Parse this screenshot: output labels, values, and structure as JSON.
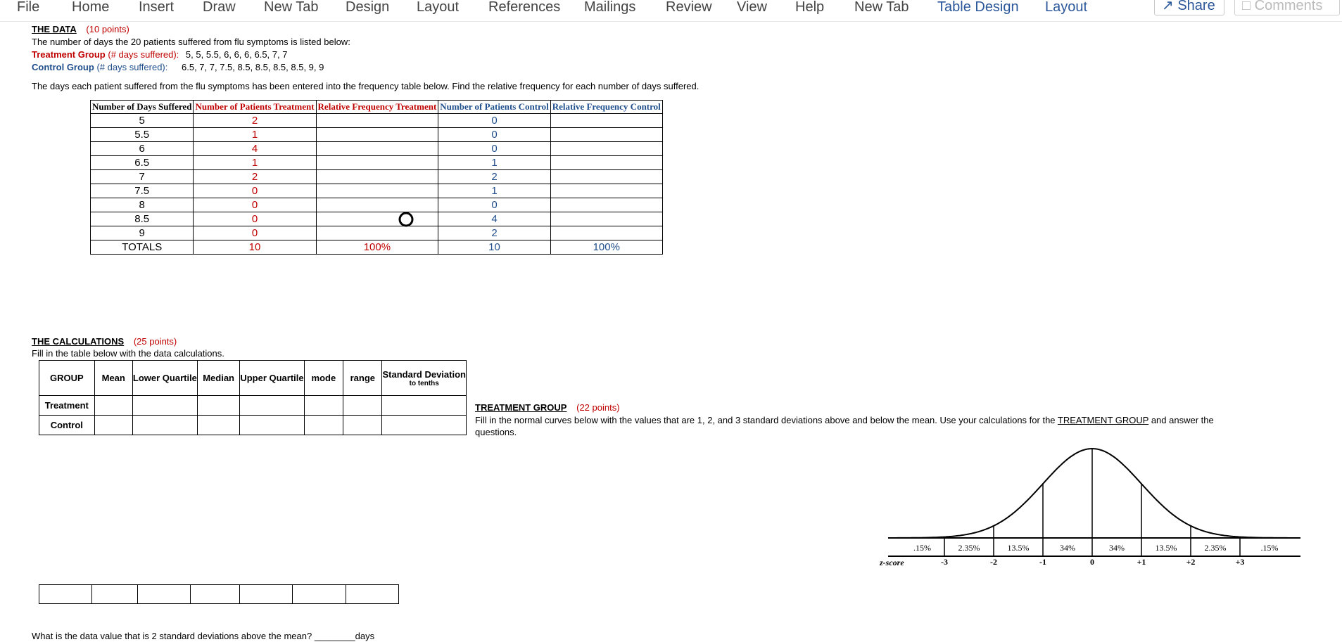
{
  "ribbon": {
    "tabs": [
      "File",
      "Home",
      "Insert",
      "Draw",
      "New Tab",
      "Design",
      "Layout",
      "References",
      "Mailings",
      "Review",
      "View",
      "Help",
      "New Tab",
      "Table Design",
      "Layout"
    ],
    "share_label": "Share",
    "comments_label": "Comments"
  },
  "data_section": {
    "heading": "THE DATA",
    "points": "(10 points)",
    "intro": "The number of days the 20 patients suffered from flu symptoms is listed below:",
    "treatment_label": "Treatment Group",
    "treatment_suffix": "(# days suffered):",
    "treatment_values": "5,   5,  5.5,   6,   6,   6,   6.5,  7,  7",
    "control_label": "Control Group",
    "control_suffix": "(# days suffered):",
    "control_values": "6.5,   7,   7,  7.5,  8.5,  8.5,  8.5,  8.5,  9,  9",
    "instruction": "The days each patient suffered from the flu symptoms has been entered into the frequency table below.  Find the relative frequency for each number of days suffered."
  },
  "freq_table": {
    "headers": [
      "Number of Days Suffered",
      "Number of Patients Treatment",
      "Relative Frequency Treatment",
      "Number of Patients Control",
      "Relative Frequency Control"
    ],
    "rows": [
      {
        "days": "5",
        "treat": "2",
        "control": "0"
      },
      {
        "days": "5.5",
        "treat": "1",
        "control": "0"
      },
      {
        "days": "6",
        "treat": "4",
        "control": "0"
      },
      {
        "days": "6.5",
        "treat": "1",
        "control": "1"
      },
      {
        "days": "7",
        "treat": "2",
        "control": "2"
      },
      {
        "days": "7.5",
        "treat": "0",
        "control": "1"
      },
      {
        "days": "8",
        "treat": "0",
        "control": "0"
      },
      {
        "days": "8.5",
        "treat": "0",
        "control": "4"
      },
      {
        "days": "9",
        "treat": "0",
        "control": "2"
      }
    ],
    "totals": {
      "label": "TOTALS",
      "treat": "10",
      "treat_rel": "100%",
      "control": "10",
      "control_rel": "100%"
    }
  },
  "calc_section": {
    "heading": "THE CALCULATIONS",
    "points": "(25 points)",
    "instruction": "Fill in the table below with the data calculations.",
    "headers": [
      "GROUP",
      "Mean",
      "Lower Quartile",
      "Median",
      "Upper Quartile",
      "mode",
      "range",
      "Standard Deviation"
    ],
    "std_note": "to tenths",
    "rows": [
      "Treatment",
      "Control"
    ]
  },
  "treatment_group": {
    "heading": "TREATMENT GROUP",
    "points": "(22 points)",
    "instruction_a": "Fill in the normal curves below with the values that are 1, 2, and 3 standard deviations above and below the mean.  Use your calculations for the ",
    "instruction_link": "TREATMENT GROUP",
    "instruction_b": " and answer the",
    "instruction_c": "questions."
  },
  "normal_curve": {
    "percents": [
      ".15%",
      "2.35%",
      "13.5%",
      "34%",
      "34%",
      "13.5%",
      "2.35%",
      ".15%"
    ],
    "zlabel": "z-score",
    "zscores": [
      "-3",
      "-2",
      "-1",
      "0",
      "+1",
      "+2",
      "+3"
    ]
  },
  "question": {
    "text": "What is the data value that is 2 standard deviations above the mean?",
    "blank": "________",
    "unit": "days"
  }
}
